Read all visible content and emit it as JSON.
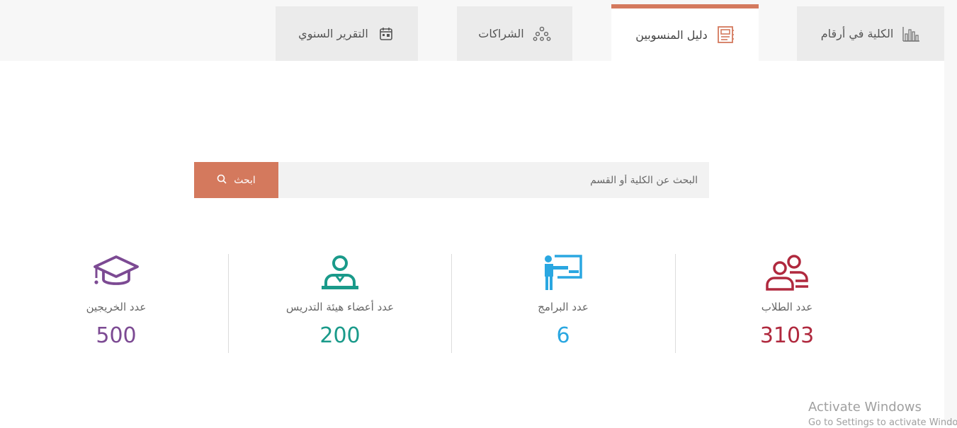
{
  "tabs": [
    {
      "label": "الكلية في أرقام",
      "icon": "bar-chart-icon",
      "active": false
    },
    {
      "label": "دليل المنسوبين",
      "icon": "directory-book-icon",
      "active": true
    },
    {
      "label": "الشراكات",
      "icon": "partnership-network-icon",
      "active": false
    },
    {
      "label": "التقرير السنوي",
      "icon": "calendar-report-icon",
      "active": false
    }
  ],
  "search": {
    "placeholder": "البحث عن الكلية أو القسم",
    "button_label": "ابحث",
    "button_icon": "search-icon"
  },
  "stats": [
    {
      "label": "عدد الطلاب",
      "value": "3103",
      "icon": "students-icon",
      "color": "#b0293e"
    },
    {
      "label": "عدد البرامج",
      "value": "6",
      "icon": "teacher-board-icon",
      "color": "#2aa7e1"
    },
    {
      "label": "عدد أعضاء هيئة التدريس",
      "value": "200",
      "icon": "faculty-member-icon",
      "color": "#1a9a8a"
    },
    {
      "label": "عدد الخريجين",
      "value": "500",
      "icon": "graduation-cap-icon",
      "color": "#7c4a93"
    }
  ],
  "colors": {
    "accent": "#d4795d",
    "tab_bg": "#ebebeb",
    "page_bg": "#ffffff"
  },
  "watermark": {
    "line1": "Activate Windows",
    "line2": "Go to Settings to activate Windows."
  }
}
